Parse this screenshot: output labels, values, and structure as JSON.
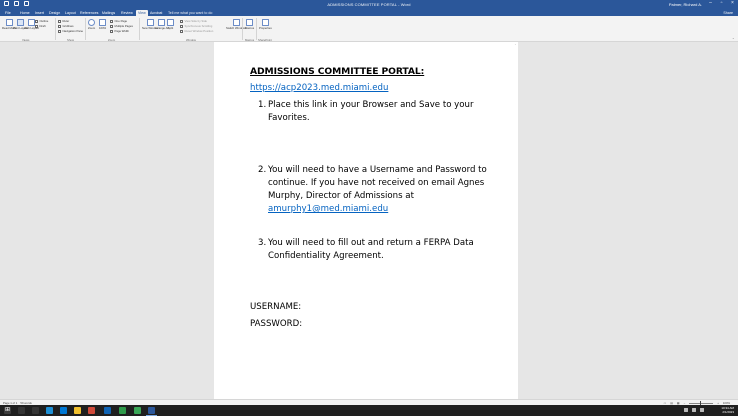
{
  "window": {
    "title": "ADMISSIONS COMMITTEE PORTAL - Word",
    "user": "Palmer, Richard A.",
    "controls": [
      "minimize-icon",
      "restore-icon",
      "close-icon"
    ]
  },
  "tabs": [
    {
      "label": "File"
    },
    {
      "label": "Home"
    },
    {
      "label": "Insert"
    },
    {
      "label": "Design"
    },
    {
      "label": "Layout"
    },
    {
      "label": "References"
    },
    {
      "label": "Mailings"
    },
    {
      "label": "Review"
    },
    {
      "label": "View"
    },
    {
      "label": "Acrobat"
    }
  ],
  "tell_me": "Tell me what you want to do",
  "share": "Share",
  "ribbon": {
    "views": {
      "read_mode": "Read Mode",
      "print_layout": "Print Layout",
      "web_layout": "Web Layout",
      "outline": "Outline",
      "draft": "Draft",
      "group": "Views"
    },
    "show": {
      "ruler": "Ruler",
      "gridlines": "Gridlines",
      "navigation_pane": "Navigation Pane",
      "group": "Show"
    },
    "zoom": {
      "zoom": "Zoom",
      "hundred": "100%",
      "one_page": "One Page",
      "multiple_pages": "Multiple Pages",
      "page_width": "Page Width",
      "group": "Zoom"
    },
    "window": {
      "new_window": "New Window",
      "arrange_all": "Arrange All",
      "split": "Split",
      "side_by_side": "View Side by Side",
      "sync_scroll": "Synchronous Scrolling",
      "reset_position": "Reset Window Position",
      "switch_windows": "Switch Windows",
      "group": "Window"
    },
    "macros": {
      "label": "Macros",
      "group": "Macros"
    },
    "sharepoint": {
      "label": "Properties",
      "group": "SharePoint"
    }
  },
  "document": {
    "heading": "ADMISSIONS COMMITTEE PORTAL:",
    "link": "https://acp2023.med.miami.edu",
    "items": [
      {
        "num": "1.",
        "lines": [
          "Place this link in your Browser and Save to your",
          "Favorites."
        ]
      },
      {
        "num": "2.",
        "lines": [
          "You will need to have a Username and Password to",
          "continue.  If you have not received on email Agnes",
          "Murphy, Director of Admissions at"
        ],
        "email": "amurphy1@med.miami.edu"
      },
      {
        "num": "3.",
        "lines": [
          "You will need to fill out and return a FERPA Data",
          "Confidentiality Agreement."
        ]
      }
    ],
    "username_label": "USERNAME:",
    "password_label": "PASSWORD:"
  },
  "statusbar": {
    "page": "Page 1 of 1",
    "words": "59 words",
    "zoom": "100%"
  },
  "taskbar": {
    "time": "10:34 AM",
    "date": "2/1/2023"
  },
  "colors": {
    "word_blue": "#2b579a",
    "hyperlink": "#0563c1",
    "taskbar": "#1f1f1f"
  }
}
